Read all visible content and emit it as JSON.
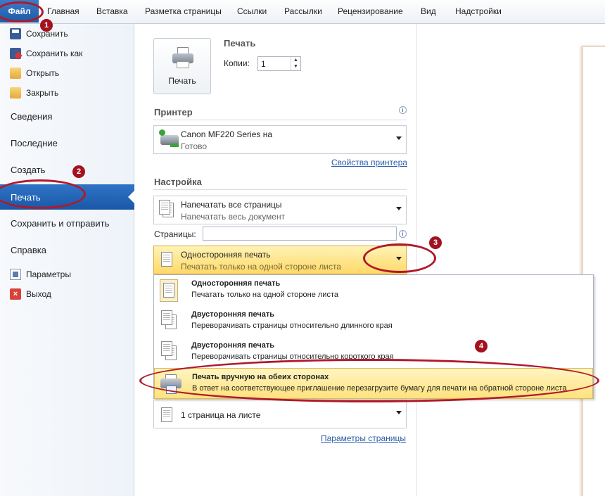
{
  "ribbon": {
    "file_tab": "Файл",
    "tabs": [
      "Главная",
      "Вставка",
      "Разметка страницы",
      "Ссылки",
      "Рассылки",
      "Рецензирование",
      "Вид",
      "Надстройки"
    ]
  },
  "leftnav": {
    "save": "Сохранить",
    "save_as": "Сохранить как",
    "open": "Открыть",
    "close": "Закрыть",
    "info": "Сведения",
    "recent": "Последние",
    "new": "Создать",
    "print": "Печать",
    "save_send": "Сохранить и отправить",
    "help": "Справка",
    "options": "Параметры",
    "exit": "Выход"
  },
  "print": {
    "button_label": "Печать",
    "heading": "Печать",
    "copies_label": "Копии:",
    "copies_value": "1"
  },
  "printer": {
    "heading": "Принтер",
    "name": "Canon MF220 Series на",
    "status": "Готово",
    "properties_link": "Свойства принтера"
  },
  "settings": {
    "heading": "Настройка",
    "range_title": "Напечатать все страницы",
    "range_subtitle": "Напечатать весь документ",
    "pages_label": "Страницы:",
    "pages_value": "",
    "duplex_title": "Односторонняя печать",
    "duplex_subtitle": "Печатать только на одной стороне листа",
    "per_sheet": "1 страница на листе",
    "page_setup_link": "Параметры страницы"
  },
  "dropdown": {
    "items": [
      {
        "title": "Односторонняя печать",
        "subtitle": "Печатать только на одной стороне листа"
      },
      {
        "title": "Двусторонняя печать",
        "subtitle": "Переворачивать страницы относительно длинного края"
      },
      {
        "title": "Двусторонняя печать",
        "subtitle": "Переворачивать страницы относительно короткого края"
      },
      {
        "title": "Печать вручную на обеих сторонах",
        "subtitle": "В ответ на соответствующее приглашение перезагрузите бумагу для печати на обратной стороне листа"
      }
    ]
  },
  "annotations": {
    "n1": "1",
    "n2": "2",
    "n3": "3",
    "n4": "4"
  },
  "colors": {
    "accent_blue": "#1f5ba6",
    "highlight_yellow": "#ffd969",
    "annotation_red": "#b0192a"
  }
}
